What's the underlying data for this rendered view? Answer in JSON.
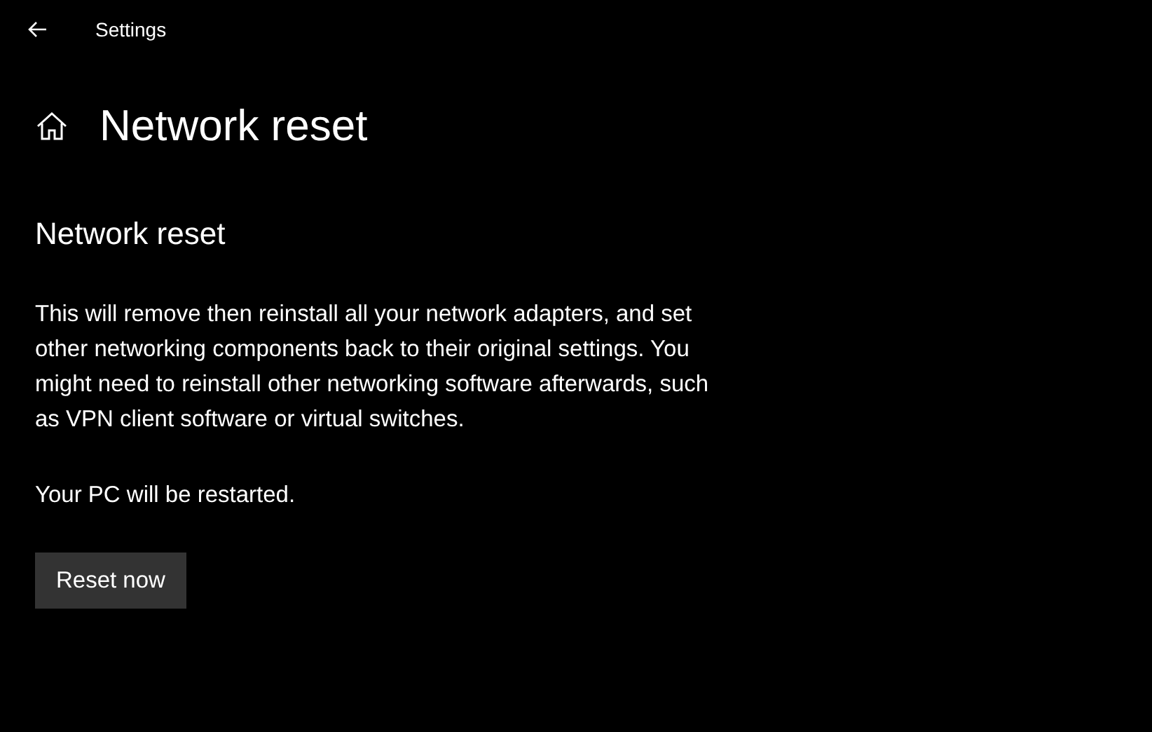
{
  "window": {
    "title": "Settings"
  },
  "page": {
    "title": "Network reset"
  },
  "section": {
    "heading": "Network reset",
    "description": "This will remove then reinstall all your network adapters, and set other networking components back to their original settings. You might need to reinstall other networking software afterwards, such as VPN client software or virtual switches.",
    "note": "Your PC will be restarted.",
    "button": "Reset now"
  }
}
